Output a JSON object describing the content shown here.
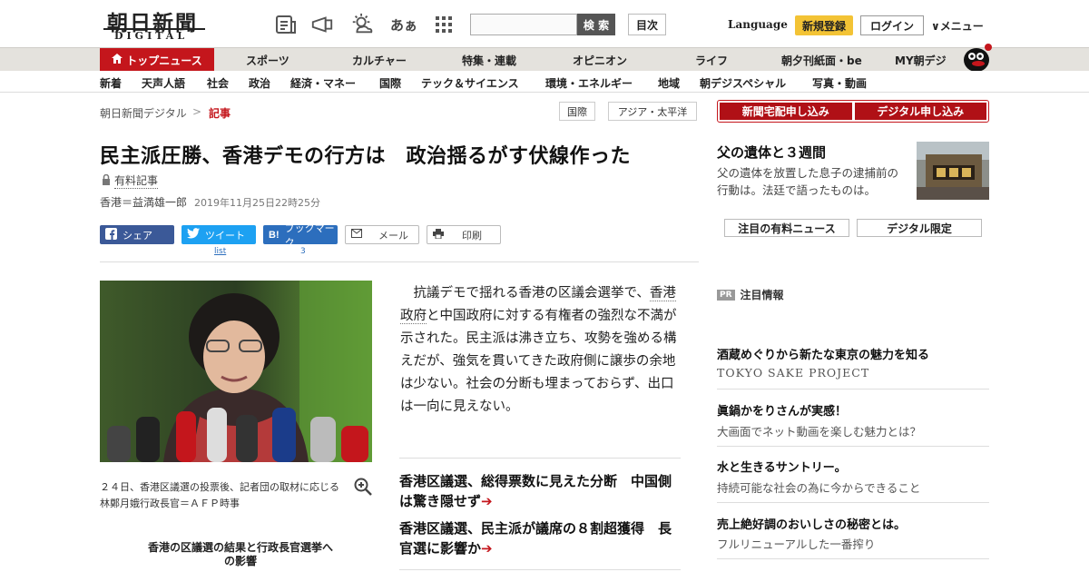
{
  "header": {
    "logo_jp": "朝日新聞",
    "logo_en": "DIGITAL",
    "kana_icon": "あぁ",
    "search_button": "検 索",
    "toc_button": "目次",
    "language": "Language",
    "signup": "新規登録",
    "login": "ログイン",
    "menu": "メニュー"
  },
  "nav1": {
    "top_news": "トップニュース",
    "items": [
      "スポーツ",
      "カルチャー",
      "特集・連載",
      "オピニオン",
      "ライフ",
      "朝夕刊紙面・be",
      "MY朝デジ"
    ]
  },
  "nav2": {
    "items": [
      "新着",
      "天声人語",
      "社会",
      "政治",
      "経済・マネー",
      "国際",
      "テック＆サイエンス",
      "環境・エネルギー",
      "地域",
      "朝デジスペシャル",
      "写真・動画"
    ]
  },
  "breadcrumb": {
    "home": "朝日新聞デジタル",
    "sep": ">",
    "current": "記事"
  },
  "tags": [
    "国際",
    "アジア・太平洋"
  ],
  "subscribe": {
    "paper": "新聞宅配申し込み",
    "digital": "デジタル申し込み"
  },
  "article": {
    "headline": "民主派圧勝、香港デモの行方は　政治揺るがす伏線作った",
    "paid_label": "有料記事",
    "byline": "香港＝益満雄一郎",
    "date": "2019年11月25日22時25分",
    "share": {
      "facebook": "シェア",
      "twitter": "ツイート",
      "hatena": "ブックマーク",
      "mail": "メール",
      "print": "印刷",
      "twitter_count": "list",
      "hatena_count": "3"
    },
    "photo_caption": "２４日、香港区議選の投票後、記者団の取材に応じる林鄭月娥行政長官＝ＡＦＰ時事",
    "promo": "香港の区議選の結果と行政長官選挙への影響",
    "body_before": "抗議デモで揺れる香港の区議会選挙で、",
    "body_link": "香港政府",
    "body_after": "と中国政府に対する有権者の強烈な不満が示された。民主派は沸き立ち、攻勢を強める構えだが、強気を貫いてきた政府側に譲歩の余地は少ない。社会の分断も埋まっておらず、出口は一向に見えない。",
    "related": [
      "香港区議選、総得票数に見えた分断　中国側は驚き隠せず",
      "香港区議選、民主派が議席の８割超獲得　長官選に影響か"
    ],
    "arrow": "➔"
  },
  "sidebar": {
    "feature_title": "父の遺体と３週間",
    "feature_desc": "父の遺体を放置した息子の逮捕前の行動は。法廷で語ったものは。",
    "btn_paid": "注目の有料ニュース",
    "btn_digital": "デジタル限定",
    "pr_badge": "PR",
    "pr_label": "注目情報",
    "ads": [
      {
        "title": "酒蔵めぐりから新たな東京の魅力を知る",
        "sub": "TOKYO SAKE PROJECT"
      },
      {
        "title": "眞鍋かをりさんが実感！",
        "sub": "大画面でネット動画を楽しむ魅力とは？"
      },
      {
        "title": "水と生きるサントリー。",
        "sub": "持続可能な社会の為に今からできること"
      },
      {
        "title": "売上絶好調のおいしさの秘密とは。",
        "sub": "フルリニューアルした一番搾り"
      }
    ]
  },
  "colors": {
    "brand_red": "#c4161c",
    "nav_bg": "#e4e2dd",
    "signup_yellow": "#f3c335"
  }
}
